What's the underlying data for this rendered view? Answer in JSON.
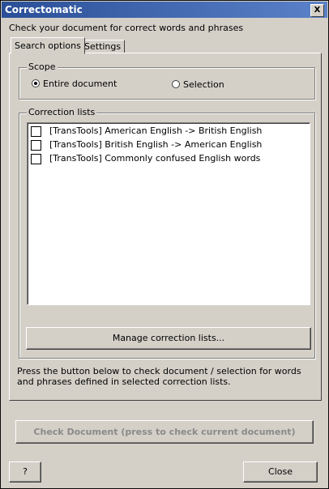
{
  "window": {
    "title": "Correctomatic",
    "close_glyph": "X"
  },
  "header": {
    "instruction": "Check your document for correct words and phrases"
  },
  "tabs": [
    {
      "label": "Search options",
      "active": true
    },
    {
      "label": "Settings",
      "active": false
    }
  ],
  "scope": {
    "label": "Scope",
    "options": [
      {
        "label": "Entire document",
        "selected": true
      },
      {
        "label": "Selection",
        "selected": false
      }
    ]
  },
  "correction_lists": {
    "label": "Correction lists",
    "items": [
      {
        "label": "[TransTools] American English -> British English",
        "checked": false
      },
      {
        "label": "[TransTools] British English -> American English",
        "checked": false
      },
      {
        "label": "[TransTools] Commonly confused English words",
        "checked": false
      }
    ],
    "manage_button": "Manage correction lists..."
  },
  "info_text": "Press the button below to check document / selection for words and phrases defined in selected correction lists.",
  "check_button": {
    "label": "Check Document (press to check current document)",
    "enabled": false
  },
  "footer": {
    "help_label": "?",
    "close_label": "Close"
  }
}
